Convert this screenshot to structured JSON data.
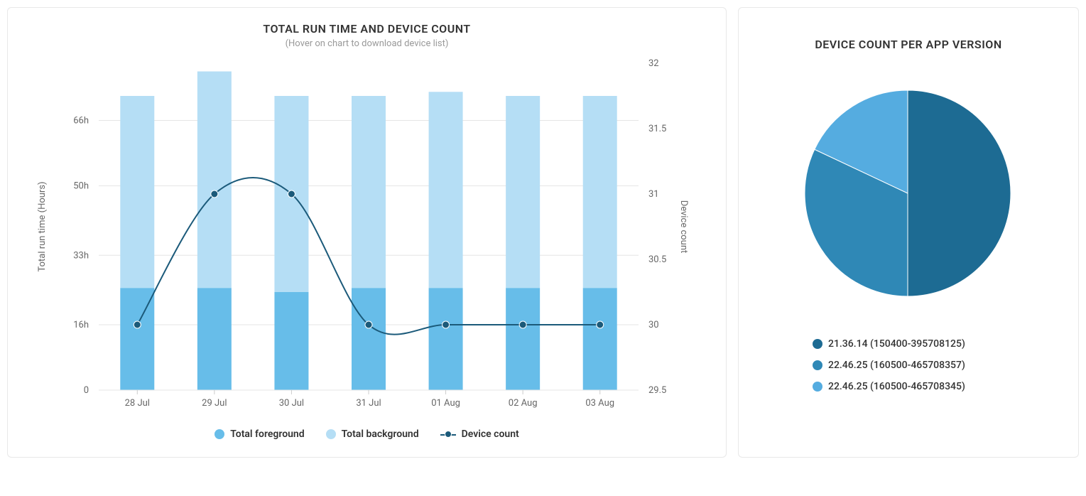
{
  "left": {
    "title": "TOTAL RUN TIME AND DEVICE COUNT",
    "subtitle": "(Hover on chart to download device list)",
    "legend": {
      "foreground": "Total foreground",
      "background": "Total background",
      "device_count": "Device count"
    }
  },
  "right": {
    "title": "DEVICE COUNT PER APP VERSION"
  },
  "colors": {
    "fg": "#67bde9",
    "bg": "#b5def5",
    "line": "#1b5a7a",
    "pie1": "#1d6b93",
    "pie2": "#2f88b6",
    "pie3": "#55ace0",
    "grid": "#e6e6e6",
    "axis": "#999"
  },
  "chart_data": [
    {
      "type": "bar+line",
      "title": "TOTAL RUN TIME AND DEVICE COUNT",
      "subtitle": "(Hover on chart to download device list)",
      "categories": [
        "28 Jul",
        "29 Jul",
        "30 Jul",
        "31 Jul",
        "01 Aug",
        "02 Aug",
        "03 Aug"
      ],
      "y1_label": "Total run time (Hours)",
      "y1_ticks": [
        0,
        16,
        33,
        50,
        66
      ],
      "y1_tick_labels": [
        "0",
        "16h",
        "33h",
        "50h",
        "66h"
      ],
      "y1_lim": [
        0,
        80
      ],
      "y2_label": "Device count",
      "y2_ticks": [
        29.5,
        30,
        30.5,
        31,
        31.5,
        32
      ],
      "y2_lim": [
        29.5,
        32
      ],
      "series": [
        {
          "name": "Total foreground",
          "role": "bar",
          "axis": "y1",
          "values": [
            25,
            25,
            24,
            25,
            25,
            25,
            25
          ]
        },
        {
          "name": "Total background",
          "role": "bar",
          "axis": "y1",
          "values": [
            47,
            53,
            48,
            47,
            48,
            47,
            47
          ]
        },
        {
          "name": "Device count",
          "role": "line",
          "axis": "y2",
          "values": [
            30,
            31,
            31,
            30,
            30,
            30,
            30
          ]
        }
      ],
      "stacked": true
    },
    {
      "type": "pie",
      "title": "DEVICE COUNT PER APP VERSION",
      "series": [
        {
          "name": "21.36.14 (150400-395708125)",
          "value": 50,
          "color": "#1d6b93"
        },
        {
          "name": "22.46.25 (160500-465708357)",
          "value": 32,
          "color": "#2f88b6"
        },
        {
          "name": "22.46.25 (160500-465708345)",
          "value": 18,
          "color": "#55ace0"
        }
      ]
    }
  ]
}
